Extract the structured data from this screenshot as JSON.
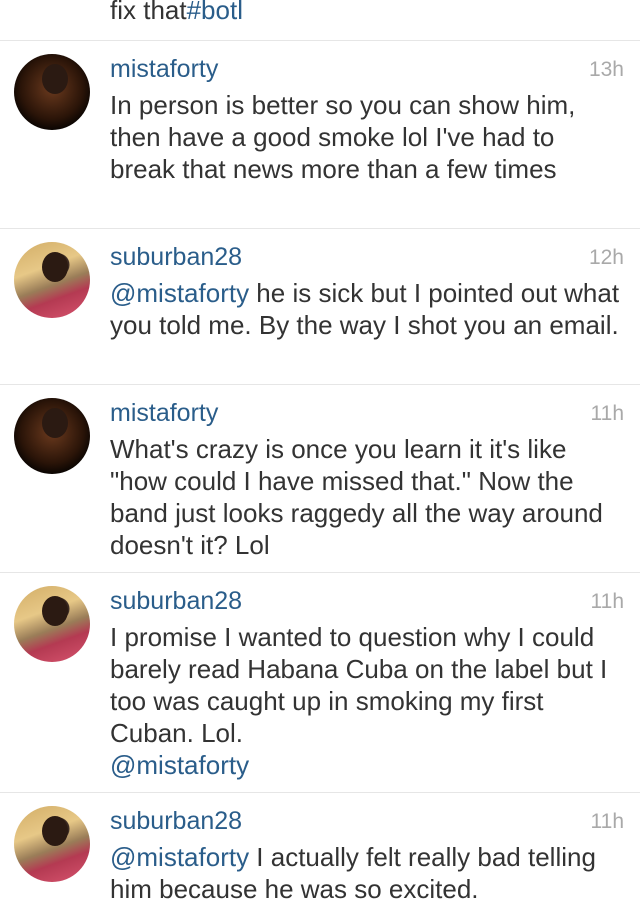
{
  "partial_top": {
    "text": "fix that",
    "hashtag": "#botl"
  },
  "comments": [
    {
      "username": "mistaforty",
      "time": "13h",
      "mention": "",
      "text": "In person is better so you can show him, then have a good smoke lol I've had to break that news more than a few times",
      "trailing_mention": ""
    },
    {
      "username": "suburban28",
      "time": "12h",
      "mention": "@mistaforty",
      "text": " he is sick but I pointed out what you told me. By the way I shot you an email.",
      "trailing_mention": ""
    },
    {
      "username": "mistaforty",
      "time": "11h",
      "mention": "",
      "text": "What's crazy is once you learn it it's like \"how could I have missed that.\" Now the band just looks raggedy all the way around doesn't it? Lol",
      "trailing_mention": ""
    },
    {
      "username": "suburban28",
      "time": "11h",
      "mention": "",
      "text": "I promise I wanted to question why I could barely read Habana Cuba on the label but I too was caught up in smoking my first Cuban. Lol.",
      "trailing_mention": "@mistaforty"
    },
    {
      "username": "suburban28",
      "time": "11h",
      "mention": "@mistaforty",
      "text": " I actually felt really bad telling him because he was so excited.",
      "trailing_mention": ""
    }
  ]
}
